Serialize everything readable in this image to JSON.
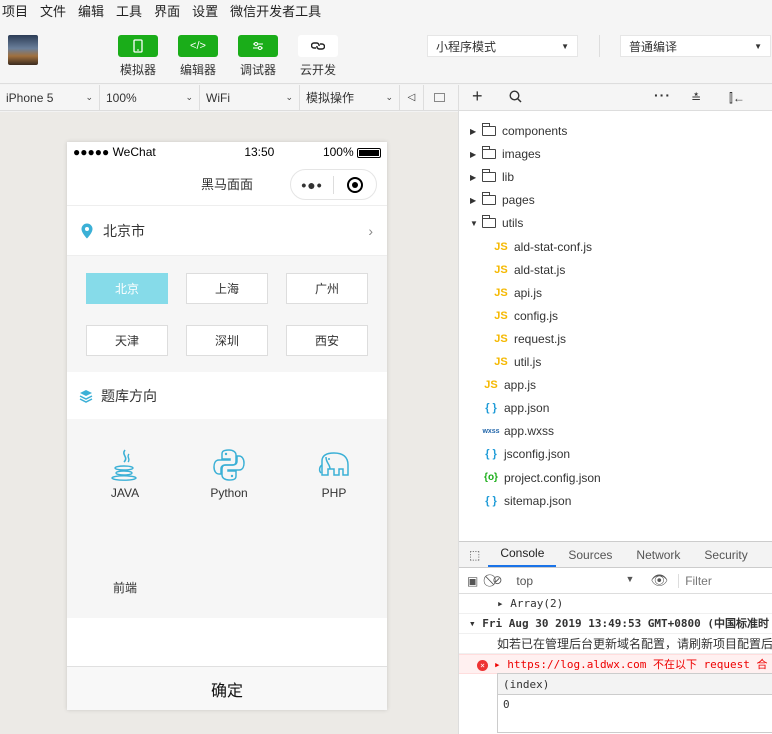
{
  "menu": [
    "项目",
    "文件",
    "编辑",
    "工具",
    "界面",
    "设置",
    "微信开发者工具"
  ],
  "toolbar": {
    "simulator": "模拟器",
    "editor": "编辑器",
    "debugger": "调试器",
    "cloud": "云开发",
    "mode": "小程序模式",
    "compile": "普通编译"
  },
  "devbar": {
    "device": "iPhone 5",
    "zoom": "100%",
    "network": "WiFi",
    "ops": "模拟操作"
  },
  "phone": {
    "carrier": "●●●●● WeChat",
    "time": "13:50",
    "battery": "100%",
    "nav_title": "黑马面面",
    "capsule_dots": "•●•",
    "location": "北京市",
    "cities": [
      "北京",
      "上海",
      "广州",
      "天津",
      "深圳",
      "西安"
    ],
    "selected_city": "北京",
    "section_title": "题库方向",
    "subjects": [
      "JAVA",
      "Python",
      "PHP",
      "前端"
    ],
    "confirm": "确定"
  },
  "filetree": [
    {
      "name": "components",
      "type": "folder",
      "open": false
    },
    {
      "name": "images",
      "type": "folder",
      "open": false
    },
    {
      "name": "lib",
      "type": "folder",
      "open": false
    },
    {
      "name": "pages",
      "type": "folder",
      "open": false
    },
    {
      "name": "utils",
      "type": "folder",
      "open": true
    },
    {
      "name": "ald-stat-conf.js",
      "type": "js",
      "depth": 1
    },
    {
      "name": "ald-stat.js",
      "type": "js",
      "depth": 1
    },
    {
      "name": "api.js",
      "type": "js",
      "depth": 1
    },
    {
      "name": "config.js",
      "type": "js",
      "depth": 1
    },
    {
      "name": "request.js",
      "type": "js",
      "depth": 1
    },
    {
      "name": "util.js",
      "type": "js",
      "depth": 1
    },
    {
      "name": "app.js",
      "type": "js"
    },
    {
      "name": "app.json",
      "type": "json"
    },
    {
      "name": "app.wxss",
      "type": "wxss"
    },
    {
      "name": "jsconfig.json",
      "type": "json"
    },
    {
      "name": "project.config.json",
      "type": "cfg"
    },
    {
      "name": "sitemap.json",
      "type": "json"
    }
  ],
  "icons": {
    "js": "JS",
    "json": "{ }",
    "wxss": "wxss",
    "cfg": "{o}"
  },
  "console": {
    "tabs": [
      "Console",
      "Sources",
      "Network",
      "Security"
    ],
    "context": "top",
    "filter_placeholder": "Filter",
    "lines": [
      "▸ Array(2)",
      "▾ Fri Aug 30 2019 13:49:53 GMT+0800 (中国标准时",
      "如若已在管理后台更新域名配置，请刷新项目配置后",
      "▸ https://log.aldwx.com 不在以下 request 合"
    ],
    "table_header": "(index)",
    "table_value": "0"
  },
  "colors": {
    "accent_green": "#1aad19",
    "city_active": "#86dbe9",
    "console_tab_underline": "#1a73e8"
  }
}
